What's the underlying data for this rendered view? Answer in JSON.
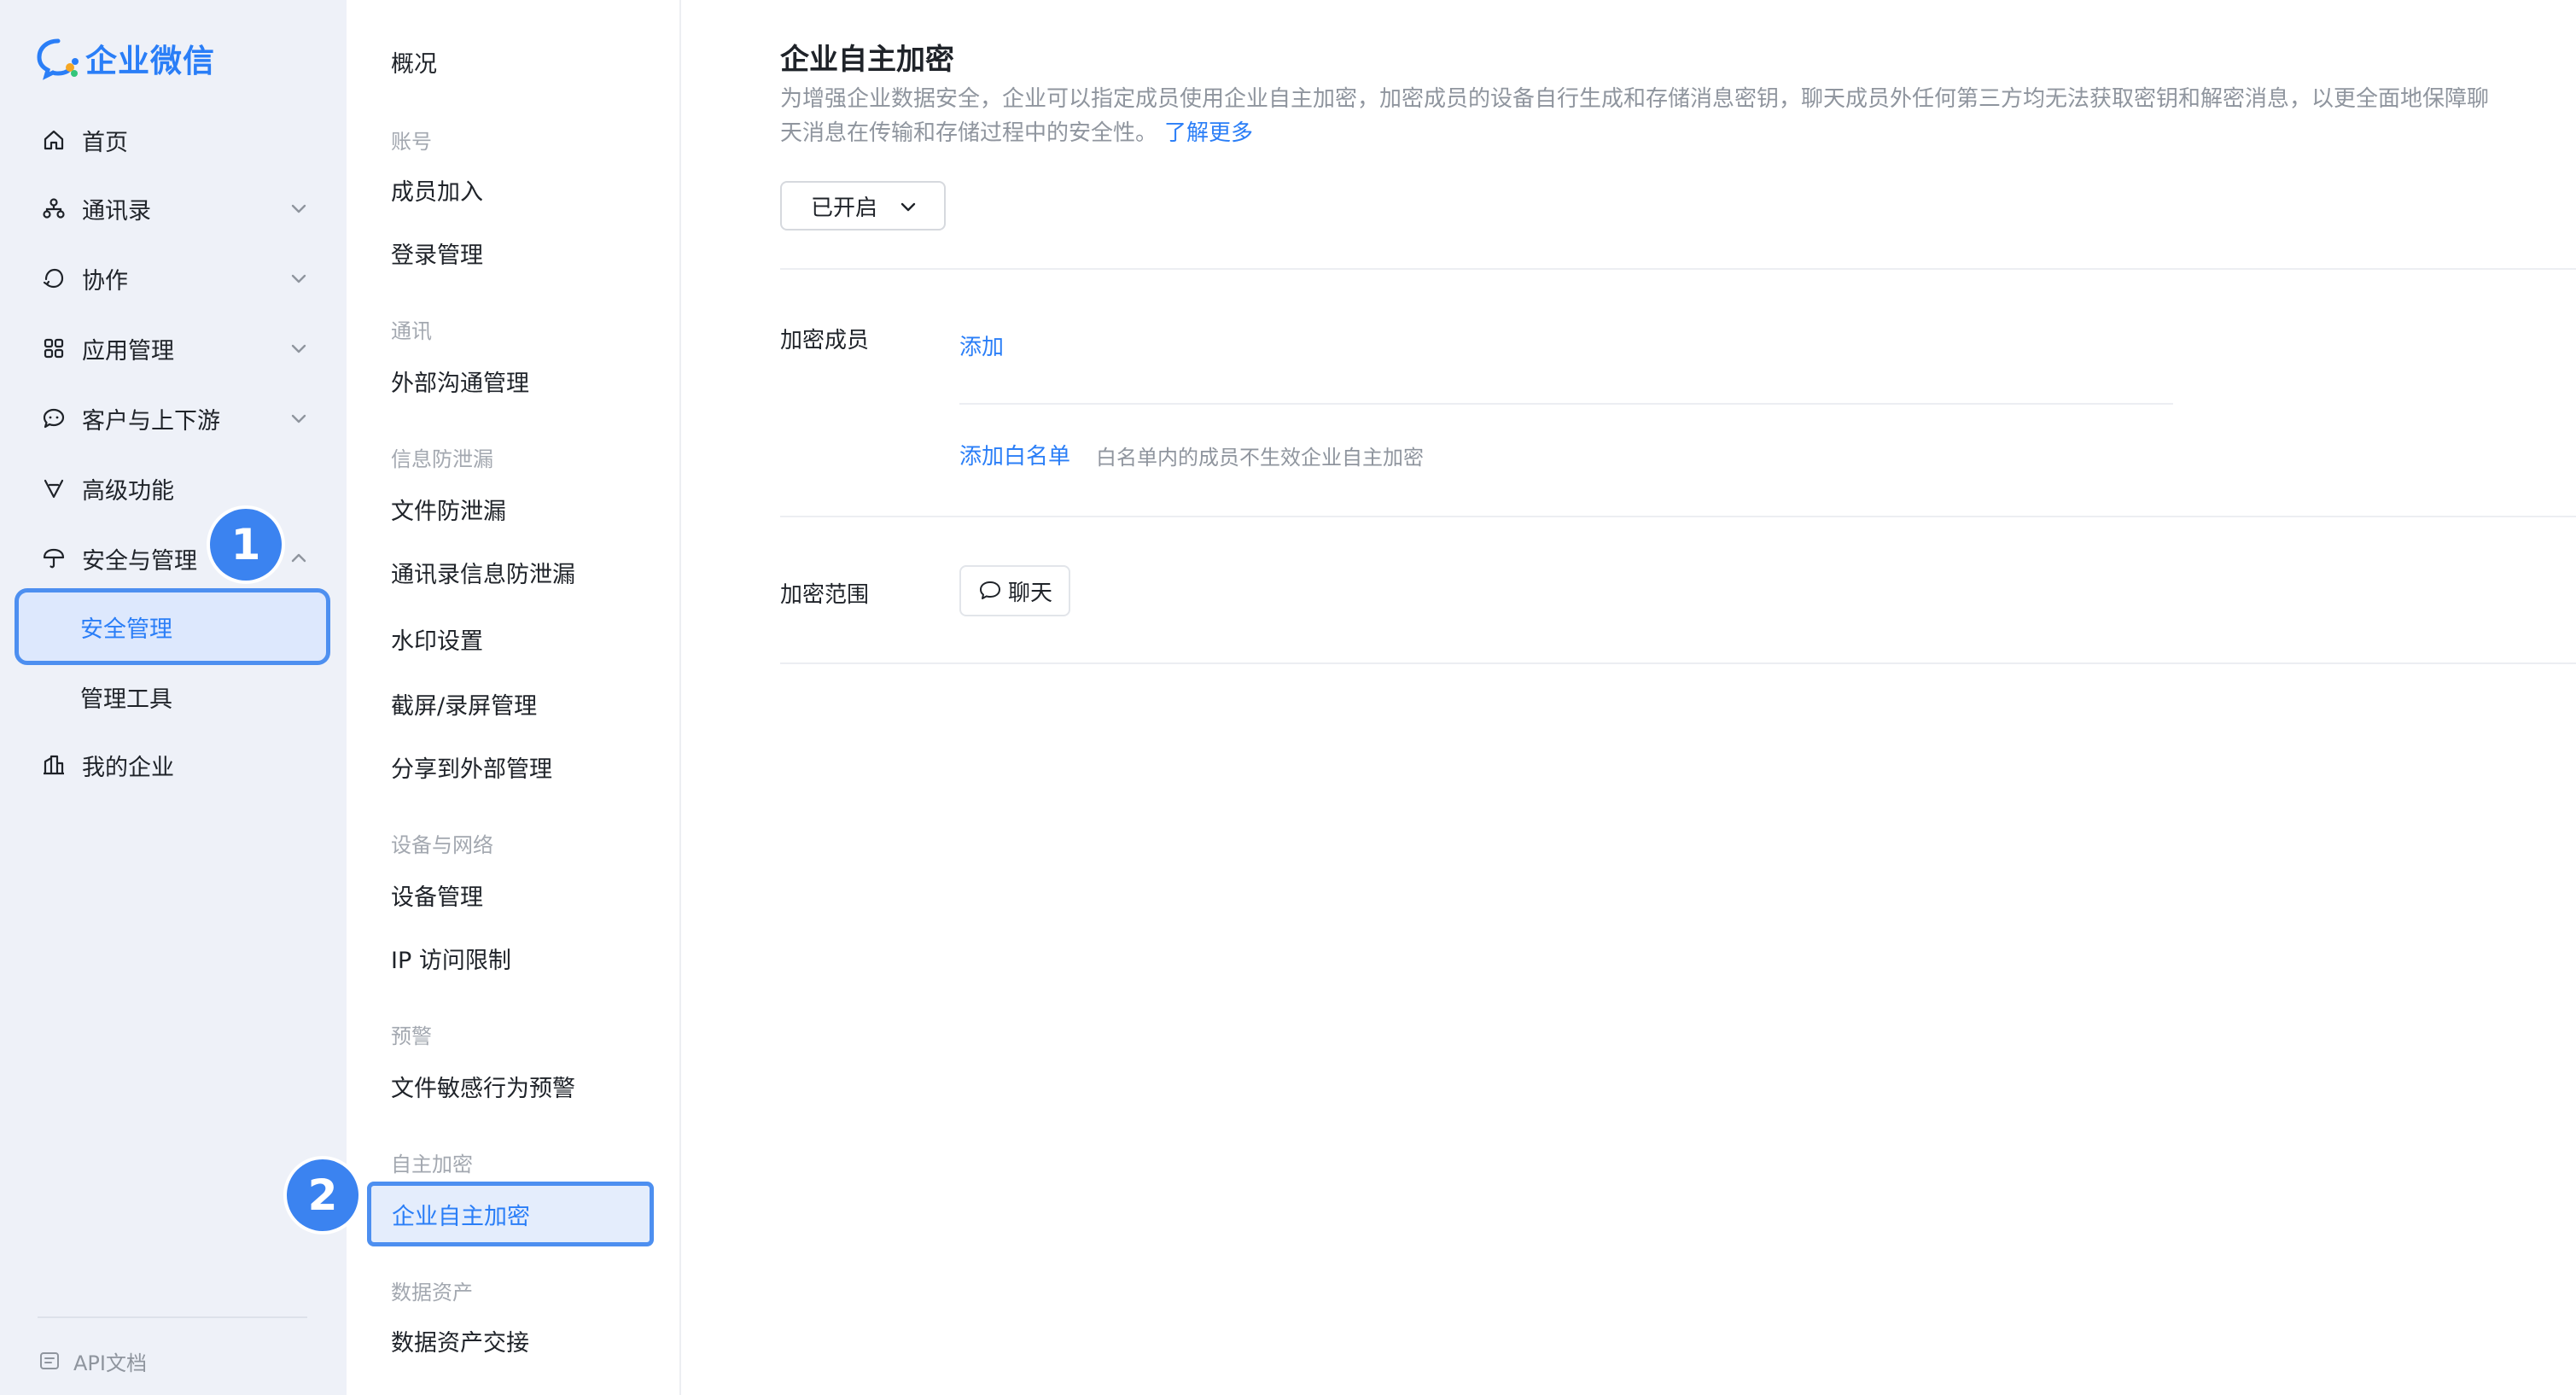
{
  "app": {
    "name": "企业微信"
  },
  "sidebar": {
    "items": [
      {
        "label": "首页",
        "icon": "home-icon"
      },
      {
        "label": "通讯录",
        "icon": "org-icon"
      },
      {
        "label": "协作",
        "icon": "collab-icon"
      },
      {
        "label": "应用管理",
        "icon": "apps-icon"
      },
      {
        "label": "客户与上下游",
        "icon": "chat-bubble-icon"
      },
      {
        "label": "高级功能",
        "icon": "advanced-icon"
      },
      {
        "label": "安全与管理",
        "icon": "umbrella-icon"
      },
      {
        "label": "我的企业",
        "icon": "building-icon"
      }
    ],
    "sub_items": [
      {
        "label": "安全管理",
        "active": true
      },
      {
        "label": "管理工具",
        "active": false
      }
    ],
    "api_doc": "API文档"
  },
  "subnav": {
    "overview": "概况",
    "groups": [
      {
        "title": "账号",
        "items": [
          "成员加入",
          "登录管理"
        ]
      },
      {
        "title": "通讯",
        "items": [
          "外部沟通管理"
        ]
      },
      {
        "title": "信息防泄漏",
        "items": [
          "文件防泄漏",
          "通讯录信息防泄漏",
          "水印设置",
          "截屏/录屏管理",
          "分享到外部管理"
        ]
      },
      {
        "title": "设备与网络",
        "items": [
          "设备管理",
          "IP 访问限制"
        ]
      },
      {
        "title": "预警",
        "items": [
          "文件敏感行为预警"
        ]
      },
      {
        "title": "自主加密",
        "items": [
          "企业自主加密"
        ]
      },
      {
        "title": "数据资产",
        "items": [
          "数据资产交接"
        ]
      }
    ]
  },
  "badges": [
    "1",
    "2"
  ],
  "main": {
    "title": "企业自主加密",
    "desc_line1": "为增强企业数据安全，企业可以指定成员使用企业自主加密，加密成员的设备自行生成和存储消息密钥，聊天成员外任何第三方均无法获取密钥和解密消息，以更全面地保障聊",
    "desc_line2": "天消息在传输和存储过程中的安全性。",
    "learn_more": "了解更多",
    "status": "已开启",
    "members_label": "加密成员",
    "add": "添加",
    "whitelist_add": "添加白名单",
    "whitelist_hint": "白名单内的成员不生效企业自主加密",
    "scope_label": "加密范围",
    "scope_chat": "聊天"
  },
  "colors": {
    "accent": "#2a7ef7",
    "highlight_border": "#4d8ff0",
    "sidebar_bg": "#eef1f8",
    "badge": "#3b83f0"
  }
}
